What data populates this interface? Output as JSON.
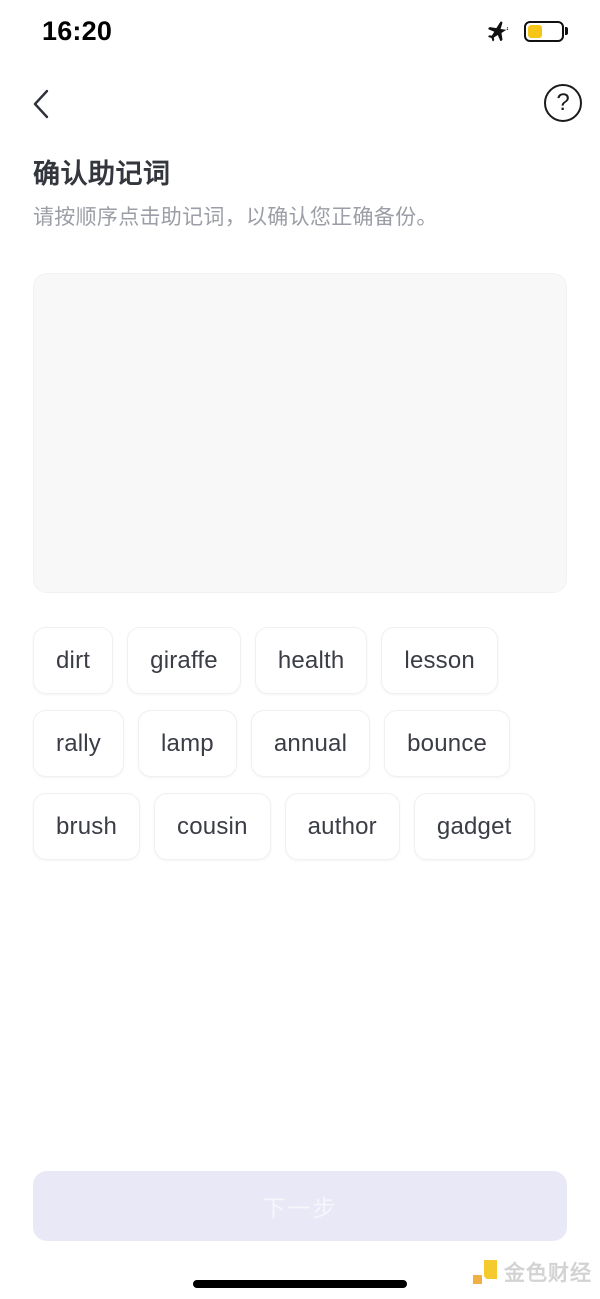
{
  "status_bar": {
    "clock": "16:20",
    "airplane_icon": "airplane-mode-icon",
    "battery_icon": "battery-icon",
    "battery_level_percent": 45,
    "battery_color": "#f5c518"
  },
  "nav": {
    "back_icon": "chevron-left-icon",
    "help_icon": "question-mark-circle-icon",
    "help_label": "?"
  },
  "heading": {
    "title": "确认助记词",
    "subtitle": "请按顺序点击助记词，以确认您正确备份。"
  },
  "answer_panel": {
    "selected_words": [],
    "placeholder_note": ""
  },
  "word_bank": {
    "words": [
      "dirt",
      "giraffe",
      "health",
      "lesson",
      "rally",
      "lamp",
      "annual",
      "bounce",
      "brush",
      "cousin",
      "author",
      "gadget"
    ]
  },
  "footer": {
    "next_label": "下一步",
    "next_enabled": false,
    "next_bg_color": "#e8e8f6",
    "next_text_color": "#f6f6fc"
  },
  "watermark": {
    "text": "金色财经",
    "logo_icon": "jinse-logo-icon",
    "logo_color": "#f5c518"
  },
  "theme": {
    "background": "#ffffff",
    "title_color": "#33363d",
    "subtitle_color": "#9b9ea6",
    "chip_bg": "#ffffff",
    "chip_border": "#f0f0f2",
    "chip_text": "#3a3d45",
    "panel_bg": "#f8f8f9"
  }
}
